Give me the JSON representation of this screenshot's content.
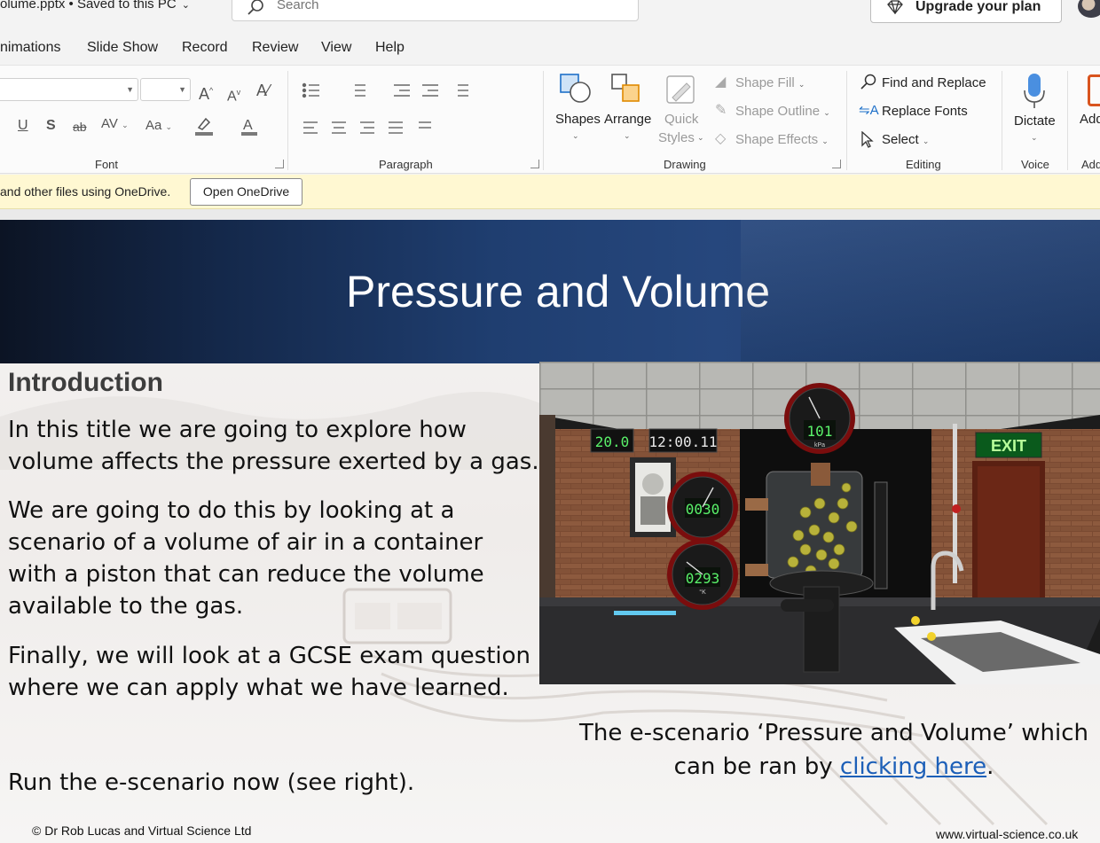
{
  "titlebar": {
    "doc_title": "olume.pptx • Saved to this PC",
    "search_placeholder": "Search",
    "upgrade_label": "Upgrade your plan"
  },
  "menu": {
    "tabs": [
      "nimations",
      "Slide Show",
      "Record",
      "Review",
      "View",
      "Help"
    ]
  },
  "ribbon": {
    "groups": {
      "font": "Font",
      "paragraph": "Paragraph",
      "drawing": "Drawing",
      "editing": "Editing",
      "voice": "Voice",
      "add": "Add"
    },
    "drawing": {
      "shapes": "Shapes",
      "arrange": "Arrange",
      "quick_styles_1": "Quick",
      "quick_styles_2": "Styles",
      "shape_fill": "Shape Fill",
      "shape_outline": "Shape Outline",
      "shape_effects": "Shape Effects"
    },
    "editing": {
      "find_replace": "Find and Replace",
      "replace_fonts": "Replace Fonts",
      "select": "Select"
    },
    "voice": {
      "dictate": "Dictate"
    },
    "add": {
      "label": "Add"
    }
  },
  "notification": {
    "text": "and other files using OneDrive.",
    "button": "Open OneDrive"
  },
  "slide": {
    "title": "Pressure and Volume",
    "heading": "Introduction",
    "paragraphs": [
      "In this title we are going to explore how volume affects the pressure exerted by a gas.",
      "We are going to do this by looking at a scenario of a volume of air in a container with a piston that can reduce the volume available to the gas.",
      "Finally, we will look at a GCSE exam question where we can apply what we have learned."
    ],
    "run_text": "Run the e-scenario now (see right).",
    "caption_before": "The e-scenario ‘Pressure and Volume’ which can be ran by ",
    "caption_link": "clicking here",
    "caption_after": ".",
    "copyright": "© Dr Rob Lucas and Virtual Science Ltd",
    "website": "www.virtual-science.co.uk",
    "image": {
      "exit_sign": "EXIT",
      "display_temp": "20.0",
      "display_clock": "12:00.11",
      "gauge_pressure": "101",
      "gauge_pressure_unit": "kPa",
      "gauge_collisions": "0030",
      "gauge_temp": "0293",
      "gauge_temp_unit": "°K"
    }
  }
}
